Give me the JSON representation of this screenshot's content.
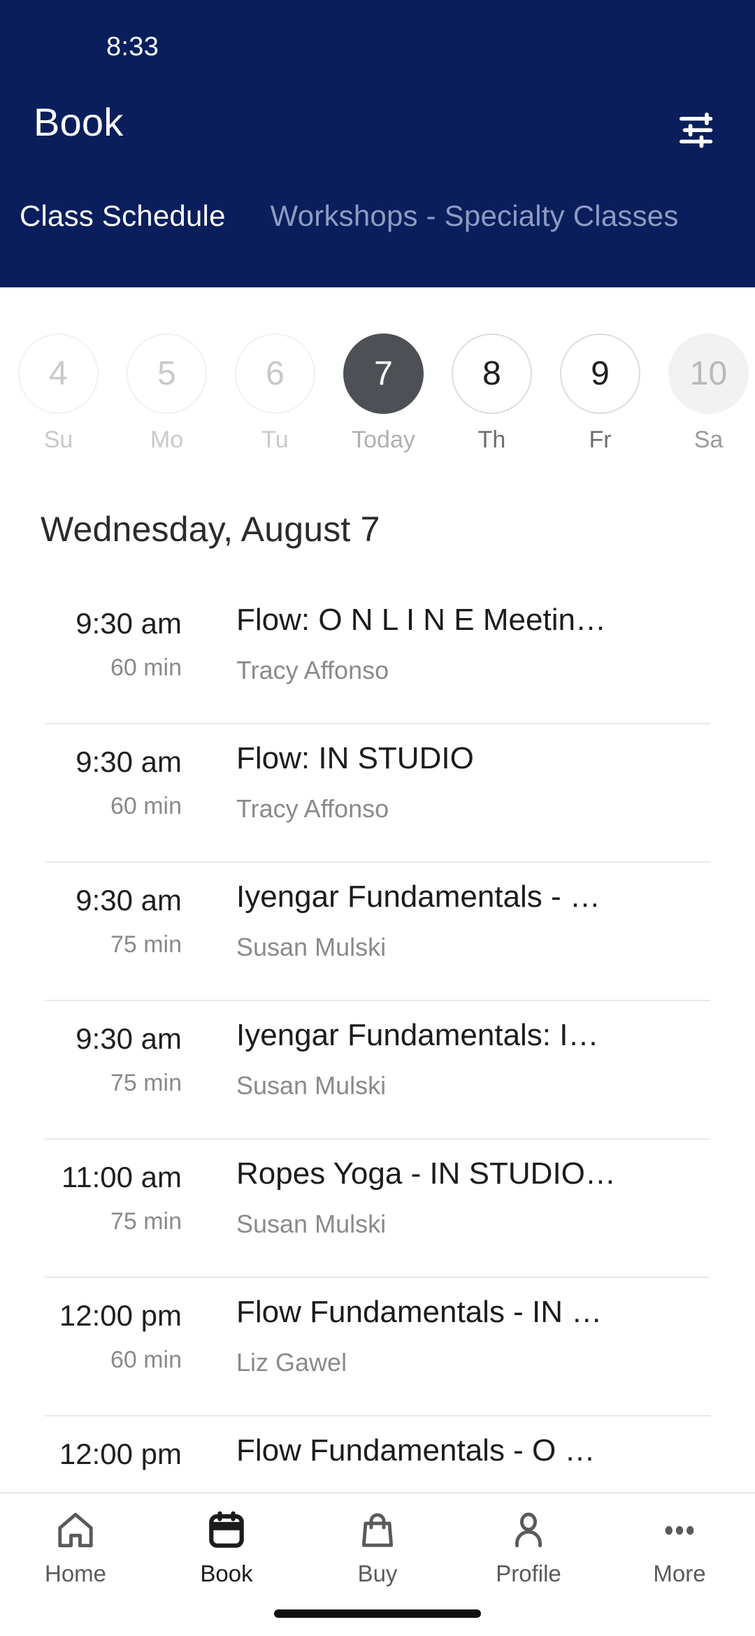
{
  "status_bar": {
    "time": "8:33"
  },
  "app_bar": {
    "title": "Book",
    "filter_icon": "tune-sliders-icon"
  },
  "tabs": [
    {
      "label": "Class Schedule",
      "active": true
    },
    {
      "label": "Workshops - Specialty Classes",
      "active": false
    }
  ],
  "date_strip": [
    {
      "day": "4",
      "weekday": "Su",
      "state": "past"
    },
    {
      "day": "5",
      "weekday": "Mo",
      "state": "past"
    },
    {
      "day": "6",
      "weekday": "Tu",
      "state": "past"
    },
    {
      "day": "7",
      "weekday": "Today",
      "state": "today"
    },
    {
      "day": "8",
      "weekday": "Th",
      "state": "future"
    },
    {
      "day": "9",
      "weekday": "Fr",
      "state": "future"
    },
    {
      "day": "10",
      "weekday": "Sa",
      "state": "muted"
    }
  ],
  "schedule": {
    "date_heading": "Wednesday, August 7",
    "classes": [
      {
        "time": "9:30 am",
        "duration": "60 min",
        "title": "Flow: O N L I N E Meetin…",
        "instructor": "Tracy Affonso"
      },
      {
        "time": "9:30 am",
        "duration": "60 min",
        "title": "Flow: IN STUDIO",
        "instructor": "Tracy Affonso"
      },
      {
        "time": "9:30 am",
        "duration": "75 min",
        "title": "Iyengar Fundamentals - …",
        "instructor": "Susan Mulski"
      },
      {
        "time": "9:30 am",
        "duration": "75 min",
        "title": "Iyengar Fundamentals: I…",
        "instructor": "Susan Mulski"
      },
      {
        "time": "11:00 am",
        "duration": "75 min",
        "title": "Ropes Yoga - IN STUDIO…",
        "instructor": "Susan Mulski"
      },
      {
        "time": "12:00 pm",
        "duration": "60 min",
        "title": "Flow Fundamentals - IN …",
        "instructor": "Liz Gawel"
      },
      {
        "time": "12:00 pm",
        "duration": "",
        "title": "Flow Fundamentals - O …",
        "instructor": ""
      }
    ]
  },
  "bottom_nav": [
    {
      "label": "Home",
      "icon": "home-icon",
      "active": false
    },
    {
      "label": "Book",
      "icon": "calendar-icon",
      "active": true
    },
    {
      "label": "Buy",
      "icon": "bag-icon",
      "active": false
    },
    {
      "label": "Profile",
      "icon": "person-icon",
      "active": false
    },
    {
      "label": "More",
      "icon": "dots-icon",
      "active": false
    }
  ],
  "colors": {
    "header_navy": "#0a1e5c",
    "tab_inactive": "#8e9bc2",
    "today_circle": "#4d5156",
    "muted_circle": "#f2f2f2",
    "text_primary": "#1c1c1c",
    "text_secondary": "#8a8a8a"
  }
}
